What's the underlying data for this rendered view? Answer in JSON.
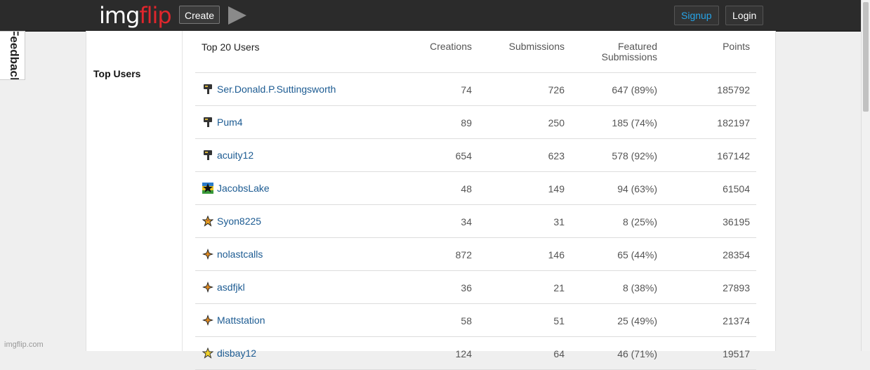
{
  "header": {
    "logo_part1": "img",
    "logo_part2": "flip",
    "create_label": "Create",
    "signup_label": "Signup",
    "login_label": "Login"
  },
  "feedback_label": "Feedback",
  "sidebar": {
    "title": "Top Users"
  },
  "table": {
    "header_user": "Top 20 Users",
    "header_creations": "Creations",
    "header_submissions": "Submissions",
    "header_featured_line1": "Featured",
    "header_featured_line2": "Submissions",
    "header_points": "Points",
    "rows": [
      {
        "name": "Ser.Donald.P.Suttingsworth",
        "icon": "hammer-icon",
        "creations": "74",
        "submissions": "726",
        "featured": "647 (89%)",
        "points": "185792"
      },
      {
        "name": "Pum4",
        "icon": "hammer-icon",
        "creations": "89",
        "submissions": "250",
        "featured": "185 (74%)",
        "points": "182197"
      },
      {
        "name": "acuity12",
        "icon": "hammer-icon",
        "creations": "654",
        "submissions": "623",
        "featured": "578 (92%)",
        "points": "167142"
      },
      {
        "name": "JacobsLake",
        "icon": "rainbow-star-icon",
        "creations": "48",
        "submissions": "149",
        "featured": "94 (63%)",
        "points": "61504"
      },
      {
        "name": "Syon8225",
        "icon": "star-icon",
        "creations": "34",
        "submissions": "31",
        "featured": "8 (25%)",
        "points": "36195"
      },
      {
        "name": "nolastcalls",
        "icon": "compass-star-icon",
        "creations": "872",
        "submissions": "146",
        "featured": "65 (44%)",
        "points": "28354"
      },
      {
        "name": "asdfjkl",
        "icon": "compass-star-icon",
        "creations": "36",
        "submissions": "21",
        "featured": "8 (38%)",
        "points": "27893"
      },
      {
        "name": "Mattstation",
        "icon": "compass-star-icon",
        "creations": "58",
        "submissions": "51",
        "featured": "25 (49%)",
        "points": "21374"
      },
      {
        "name": "disbay12",
        "icon": "yellow-star-icon",
        "creations": "124",
        "submissions": "64",
        "featured": "46 (71%)",
        "points": "19517"
      }
    ]
  },
  "footer": {
    "url": "imgflip.com"
  },
  "colors": {
    "brand_red": "#e0262c",
    "link": "#1c5b92",
    "signup": "#26a4e8",
    "topbar": "#2b2b2b"
  }
}
